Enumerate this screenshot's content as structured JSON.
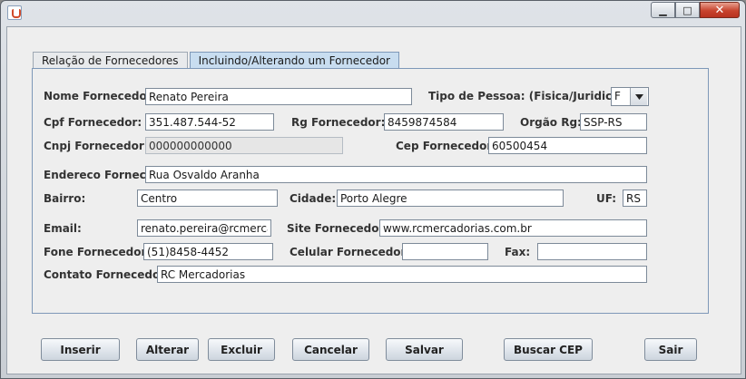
{
  "window": {
    "title": "",
    "controls": {
      "minimize": "▁",
      "maximize": "□",
      "close": "✕"
    }
  },
  "tabs": [
    {
      "label": "Relação de Fornecedores",
      "active": false
    },
    {
      "label": "Incluindo/Alterando um Fornecedor",
      "active": true
    }
  ],
  "form": {
    "nome": {
      "label": "Nome Fornecedor:",
      "value": "Renato Pereira"
    },
    "tipo": {
      "label": "Tipo de Pessoa: (Fisica/Juridica)",
      "value": "F"
    },
    "cpf": {
      "label": "Cpf Fornecedor:",
      "value": "351.487.544-52"
    },
    "rg": {
      "label": "Rg Fornecedor:",
      "value": "8459874584"
    },
    "orgao": {
      "label": "Orgão Rg:",
      "value": "SSP-RS"
    },
    "cnpj": {
      "label": "Cnpj Fornecedor:",
      "value": "000000000000"
    },
    "cep": {
      "label": "Cep Fornecedor:",
      "value": "60500454"
    },
    "endereco": {
      "label": "Endereco Fornec.:",
      "value": "Rua Osvaldo Aranha"
    },
    "bairro": {
      "label": "Bairro:",
      "value": "Centro"
    },
    "cidade": {
      "label": "Cidade:",
      "value": "Porto Alegre"
    },
    "uf": {
      "label": "UF:",
      "value": "RS"
    },
    "email": {
      "label": "Email:",
      "value": "renato.pereira@rcmercad"
    },
    "site": {
      "label": "Site Fornecedor:",
      "value": "www.rcmercadorias.com.br"
    },
    "fone": {
      "label": "Fone Fornecedor:",
      "value": "(51)8458-4452"
    },
    "celular": {
      "label": "Celular Fornecedor:",
      "value": ""
    },
    "fax": {
      "label": "Fax:",
      "value": ""
    },
    "contato": {
      "label": "Contato Fornecedor:",
      "value": "RC Mercadorias"
    }
  },
  "buttons": {
    "inserir": "Inserir",
    "alterar": "Alterar",
    "excluir": "Excluir",
    "cancelar": "Cancelar",
    "salvar": "Salvar",
    "buscar_cep": "Buscar CEP",
    "sair": "Sair"
  }
}
